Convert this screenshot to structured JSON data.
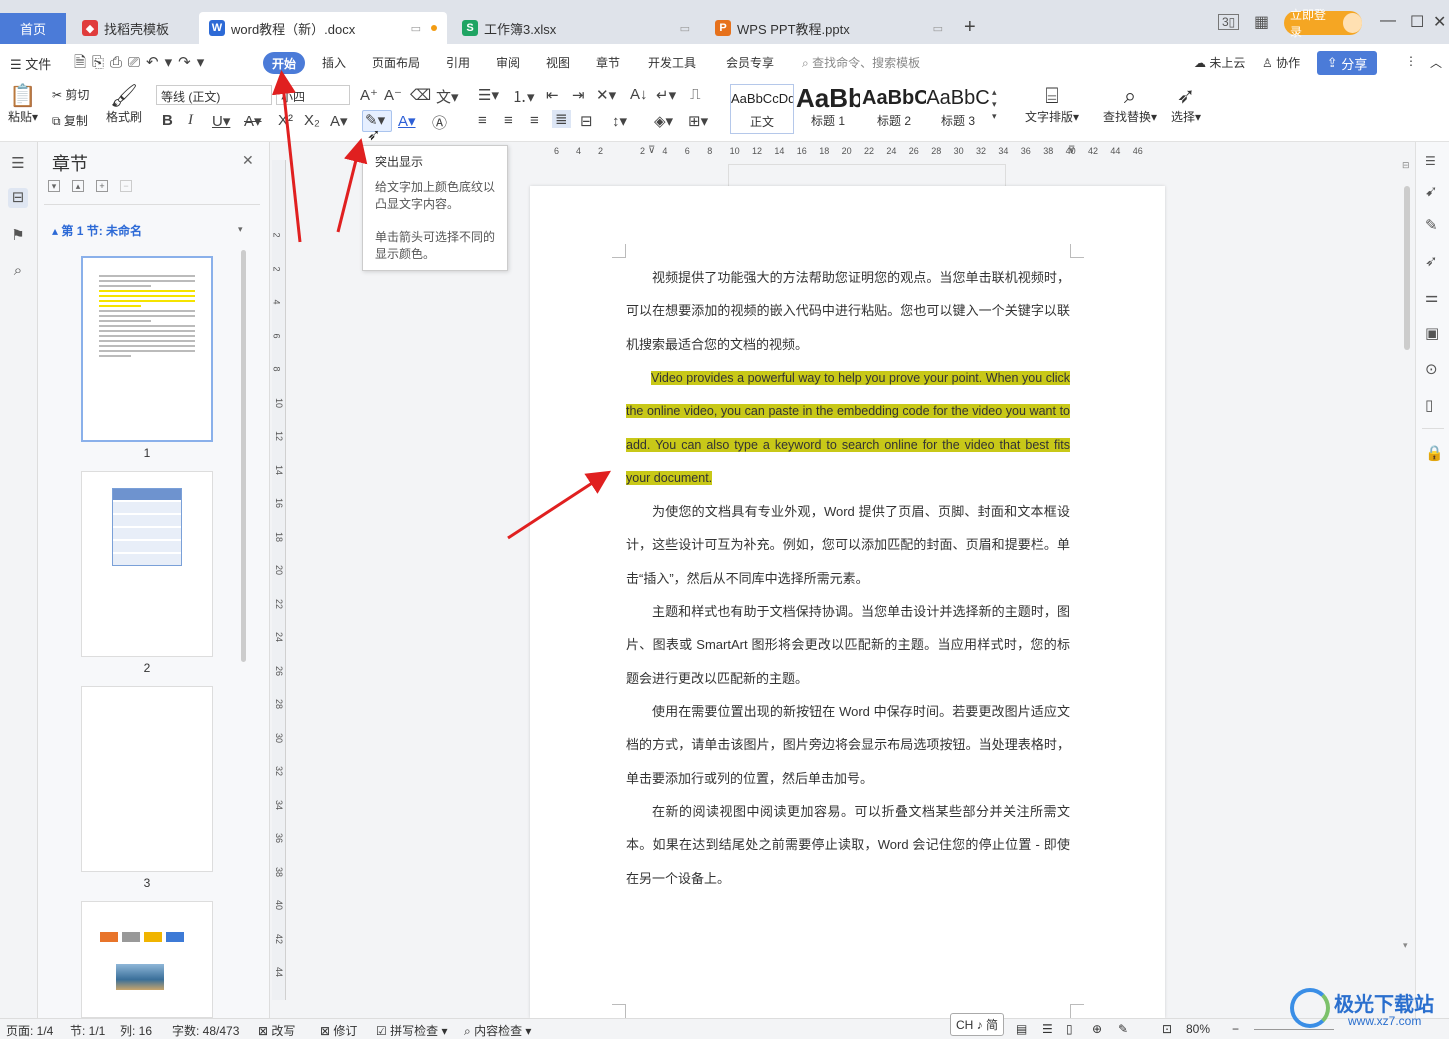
{
  "tabs": {
    "home": "首页",
    "template": "找稻壳模板",
    "doc": "word教程（新）.docx",
    "xlsx": "工作簿3.xlsx",
    "pptx": "WPS PPT教程.pptx",
    "add": "+"
  },
  "titlebar": {
    "login": "立即登录",
    "layout_icon": "3▯"
  },
  "menu": {
    "file": "文件",
    "items": [
      "开始",
      "插入",
      "页面布局",
      "引用",
      "审阅",
      "视图",
      "章节",
      "开发工具",
      "会员专享"
    ],
    "search_placeholder": "查找命令、搜索模板",
    "cloud": "未上云",
    "collab": "协作",
    "share": "分享"
  },
  "ribbon": {
    "paste": "粘贴",
    "cut": "剪切",
    "copy": "复制",
    "format_painter": "格式刷",
    "font_name": "等线 (正文)",
    "font_size": "小四",
    "styles": [
      {
        "preview": "AaBbCcDd",
        "label": "正文"
      },
      {
        "preview": "AaBb",
        "label": "标题 1"
      },
      {
        "preview": "AaBbC",
        "label": "标题 2"
      },
      {
        "preview": "AaBbC",
        "label": "标题 3"
      }
    ],
    "text_layout": "文字排版",
    "find_replace": "查找替换",
    "select": "选择"
  },
  "tooltip": {
    "title": "突出显示",
    "line1": "给文字加上颜色底纹以凸显文字内容。",
    "line2": "单击箭头可选择不同的显示颜色。"
  },
  "panel": {
    "title": "章节",
    "section": "第 1 节: 未命名",
    "pages": [
      "1",
      "2",
      "3"
    ]
  },
  "ruler": {
    "h": [
      "6",
      "4",
      "2",
      "2",
      "4",
      "6",
      "8",
      "10",
      "12",
      "14",
      "16",
      "18",
      "20",
      "22",
      "24",
      "26",
      "28",
      "30",
      "32",
      "34",
      "36",
      "38",
      "40",
      "42",
      "44",
      "46"
    ],
    "v": [
      "2",
      "2",
      "4",
      "6",
      "8",
      "10",
      "12",
      "14",
      "16",
      "18",
      "20",
      "22",
      "24",
      "26",
      "28",
      "30",
      "32",
      "34",
      "36",
      "38",
      "40",
      "42",
      "44"
    ]
  },
  "document": {
    "p1": "视频提供了功能强大的方法帮助您证明您的观点。当您单击联机视频时，可以在想要添加的视频的嵌入代码中进行粘贴。您也可以键入一个关键字以联机搜索最适合您的文档的视频。",
    "p2_lines": [
      "Video provides a powerful way to help you prove your point. When you click",
      "the online video, you can paste in the embedding code for the video you want to",
      "add. You can also type a keyword to search online for the video that best fits",
      "your document."
    ],
    "p3": "为使您的文档具有专业外观，Word 提供了页眉、页脚、封面和文本框设计，这些设计可互为补充。例如，您可以添加匹配的封面、页眉和提要栏。单击“插入”，然后从不同库中选择所需元素。",
    "p4": "主题和样式也有助于文档保持协调。当您单击设计并选择新的主题时，图片、图表或 SmartArt 图形将会更改以匹配新的主题。当应用样式时，您的标题会进行更改以匹配新的主题。",
    "p5": "使用在需要位置出现的新按钮在 Word 中保存时间。若要更改图片适应文档的方式，请单击该图片，图片旁边将会显示布局选项按钮。当处理表格时，单击要添加行或列的位置，然后单击加号。",
    "p6": "在新的阅读视图中阅读更加容易。可以折叠文档某些部分并关注所需文本。如果在达到结尾处之前需要停止读取，Word 会记住您的停止位置 - 即使在另一个设备上。"
  },
  "status": {
    "page": "页面: 1/4",
    "section": "节: 1/1",
    "col": "列: 16",
    "words": "字数: 48/473",
    "rewrite": "改写",
    "revise": "修订",
    "spell": "拼写检查",
    "content_check": "内容检查",
    "ime": "CH ♪ 简",
    "zoom": "80%"
  },
  "watermark": {
    "brand": "极光下载站",
    "url": "www.xz7.com"
  },
  "colors": {
    "accent": "#4b7bd8",
    "highlight": "#c8c818",
    "arrow": "#e02020",
    "login": "#f5a623"
  }
}
